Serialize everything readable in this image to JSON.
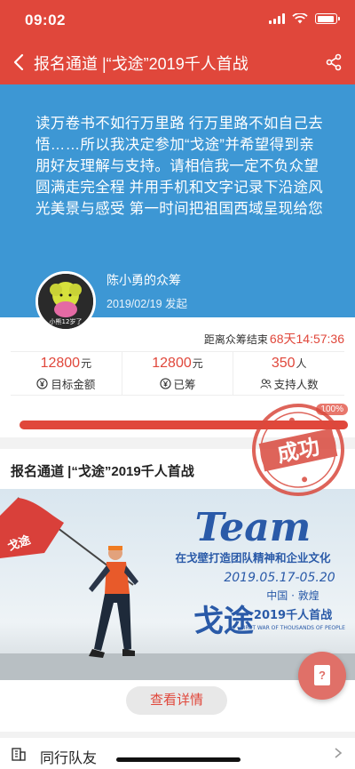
{
  "status": {
    "time": "09:02"
  },
  "nav": {
    "title": "报名通道 |“戈途”2019千人首战"
  },
  "hero": {
    "description": "读万卷书不如行万里路 行万里路不如自己去悟……所以我决定参加“戈途”并希望得到亲朋好友理解与支持。请相信我一定不负众望 圆满走完全程 并用手机和文字记录下沿途风光美景与感受 第一时间把祖国西域呈现给您",
    "owner": "陈小勇的众筹",
    "date": "2019/02/19 发起",
    "avatar_caption": "小熊12岁了"
  },
  "stats": {
    "countdown_label": "距离众筹结束",
    "countdown_value": "68天14:57:36",
    "items": [
      {
        "value": "12800",
        "unit": "元",
        "label": "目标金额"
      },
      {
        "value": "12800",
        "unit": "元",
        "label": "已筹"
      },
      {
        "value": "350",
        "unit": "人",
        "label": "支持人数"
      }
    ],
    "progress_percent": 100,
    "progress_label": "100%",
    "stamp_text": "成功"
  },
  "article": {
    "title": "报名通道 |“戈途”2019千人首战",
    "flag_text": "戈途",
    "banner_title": "Team",
    "banner_slogan": "在戈壁打造团队精神和企业文化",
    "banner_dates": "2019.05.17-05.20",
    "banner_location": "中国 · 敦煌",
    "banner_brand": "戈途",
    "banner_tag": "2019千人首战",
    "banner_en": "FIRST WAR OF THOUSANDS OF PEOPLE",
    "detail_button": "查看详情"
  },
  "fab": {
    "glyph": "?"
  },
  "teammates": {
    "label": "同行队友"
  },
  "colors": {
    "brand_red": "#e0473b",
    "hero_blue": "#3d97d4"
  }
}
